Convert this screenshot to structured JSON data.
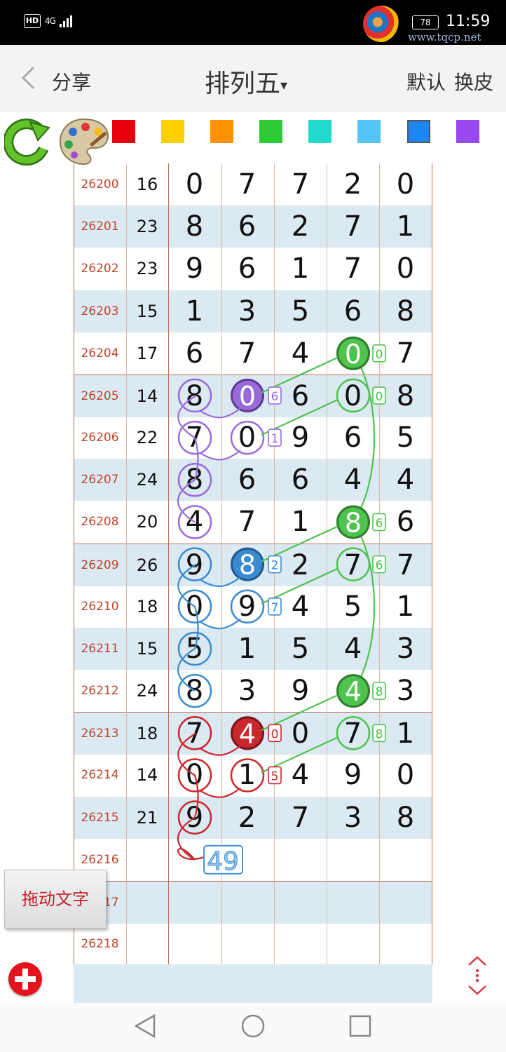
{
  "status_bar": {
    "hd": "HD",
    "network": "4G",
    "battery": "78",
    "time": "11:59",
    "watermark_url": "www.tqcp.net"
  },
  "nav": {
    "back_label": "分享",
    "title": "排列五",
    "caret": "▾",
    "default_label": "默认",
    "skin_label": "换皮"
  },
  "palette": {
    "swatches": [
      "#e8000b",
      "#ffd000",
      "#ff9200",
      "#2ccc36",
      "#22dacb",
      "#55c4f6",
      "#1c86f2",
      "#9a48ef"
    ],
    "selected_index": 6
  },
  "table": {
    "rows": [
      {
        "issue": "26200",
        "sum": "16",
        "d": [
          "0",
          "7",
          "7",
          "2",
          "0"
        ]
      },
      {
        "issue": "26201",
        "sum": "23",
        "d": [
          "8",
          "6",
          "2",
          "7",
          "1"
        ]
      },
      {
        "issue": "26202",
        "sum": "23",
        "d": [
          "9",
          "6",
          "1",
          "7",
          "0"
        ]
      },
      {
        "issue": "26203",
        "sum": "15",
        "d": [
          "1",
          "3",
          "5",
          "6",
          "8"
        ]
      },
      {
        "issue": "26204",
        "sum": "17",
        "d": [
          "6",
          "7",
          "4",
          "0",
          "7"
        ]
      },
      {
        "issue": "26205",
        "sum": "14",
        "d": [
          "8",
          "0",
          "6",
          "0",
          "8"
        ]
      },
      {
        "issue": "26206",
        "sum": "22",
        "d": [
          "7",
          "0",
          "9",
          "6",
          "5"
        ]
      },
      {
        "issue": "26207",
        "sum": "24",
        "d": [
          "8",
          "6",
          "6",
          "4",
          "4"
        ]
      },
      {
        "issue": "26208",
        "sum": "20",
        "d": [
          "4",
          "7",
          "1",
          "8",
          "6"
        ]
      },
      {
        "issue": "26209",
        "sum": "26",
        "d": [
          "9",
          "8",
          "2",
          "7",
          "7"
        ]
      },
      {
        "issue": "26210",
        "sum": "18",
        "d": [
          "0",
          "9",
          "4",
          "5",
          "1"
        ]
      },
      {
        "issue": "26211",
        "sum": "15",
        "d": [
          "5",
          "1",
          "5",
          "4",
          "3"
        ]
      },
      {
        "issue": "26212",
        "sum": "24",
        "d": [
          "8",
          "3",
          "9",
          "4",
          "3"
        ]
      },
      {
        "issue": "26213",
        "sum": "18",
        "d": [
          "7",
          "4",
          "0",
          "7",
          "1"
        ]
      },
      {
        "issue": "26214",
        "sum": "14",
        "d": [
          "0",
          "1",
          "4",
          "9",
          "0"
        ]
      },
      {
        "issue": "26215",
        "sum": "21",
        "d": [
          "9",
          "2",
          "7",
          "3",
          "8"
        ]
      },
      {
        "issue": "26216",
        "sum": "",
        "d": [
          "",
          "",
          "",
          "",
          ""
        ]
      },
      {
        "issue": "26217",
        "sum": "",
        "d": [
          "",
          "",
          "",
          "",
          ""
        ]
      },
      {
        "issue": "26218",
        "sum": "",
        "d": [
          "",
          "",
          "",
          "",
          ""
        ]
      }
    ],
    "annotations": {
      "small_boxes": [
        {
          "row": 4,
          "text": "0",
          "color": "#4ec34e"
        },
        {
          "row": 5,
          "text": "6",
          "color": "#9a6bd8"
        },
        {
          "row": 5,
          "text": "0",
          "color": "#4ec34e"
        },
        {
          "row": 6,
          "text": "1",
          "color": "#9a6bd8"
        },
        {
          "row": 8,
          "text": "6",
          "color": "#4ec34e"
        },
        {
          "row": 9,
          "text": "2",
          "color": "#3a8bd0"
        },
        {
          "row": 9,
          "text": "6",
          "color": "#4ec34e"
        },
        {
          "row": 10,
          "text": "7",
          "color": "#3a8bd0"
        },
        {
          "row": 12,
          "text": "8",
          "color": "#4ec34e"
        },
        {
          "row": 13,
          "text": "0",
          "color": "#c9282c"
        },
        {
          "row": 13,
          "text": "8",
          "color": "#4ec34e"
        },
        {
          "row": 14,
          "text": "5",
          "color": "#c9282c"
        }
      ],
      "forecast_box": {
        "row": 16,
        "text": "49",
        "color": "#3a8bd0"
      }
    }
  },
  "controls": {
    "drag_text_label": "拖动文字"
  }
}
